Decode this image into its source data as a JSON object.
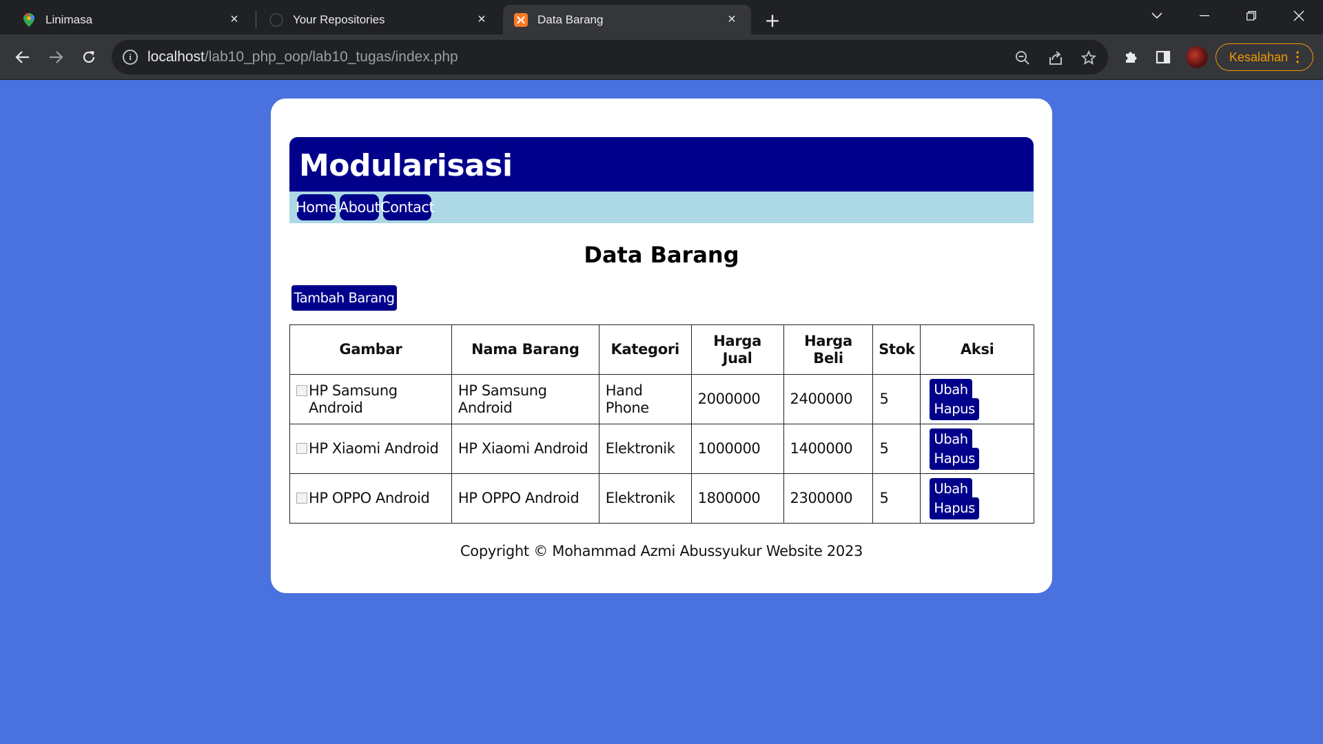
{
  "browser": {
    "tabs": [
      {
        "title": "Linimasa",
        "icon": "google-maps-pin-icon"
      },
      {
        "title": "Your Repositories",
        "icon": "github-icon"
      },
      {
        "title": "Data Barang",
        "icon": "xampp-icon"
      }
    ],
    "url_host": "localhost",
    "url_path": "/lab10_php_oop/lab10_tugas/index.php",
    "error_button": "Kesalahan"
  },
  "page": {
    "header_title": "Modularisasi",
    "nav": [
      "Home",
      "About",
      "Contact"
    ],
    "title": "Data Barang",
    "add_button": "Tambah Barang",
    "table": {
      "headers": [
        "Gambar",
        "Nama Barang",
        "Kategori",
        "Harga Jual",
        "Harga Beli",
        "Stok",
        "Aksi"
      ],
      "rows": [
        {
          "gambar_alt": "HP Samsung Android",
          "nama": "HP Samsung Android",
          "kategori": "Hand Phone",
          "harga_jual": "2000000",
          "harga_beli": "2400000",
          "stok": "5",
          "ubah": "Ubah",
          "hapus": "Hapus"
        },
        {
          "gambar_alt": "HP Xiaomi Android",
          "nama": "HP Xiaomi Android",
          "kategori": "Elektronik",
          "harga_jual": "1000000",
          "harga_beli": "1400000",
          "stok": "5",
          "ubah": "Ubah",
          "hapus": "Hapus"
        },
        {
          "gambar_alt": "HP OPPO Android",
          "nama": "HP OPPO Android",
          "kategori": "Elektronik",
          "harga_jual": "1800000",
          "harga_beli": "2300000",
          "stok": "5",
          "ubah": "Ubah",
          "hapus": "Hapus"
        }
      ]
    },
    "footer": "Copyright © Mohammad Azmi Abussyukur Website 2023"
  },
  "colors": {
    "background": "#4a72de",
    "header": "#00008b",
    "nav_bar": "#add8e6",
    "button": "#00008b"
  }
}
